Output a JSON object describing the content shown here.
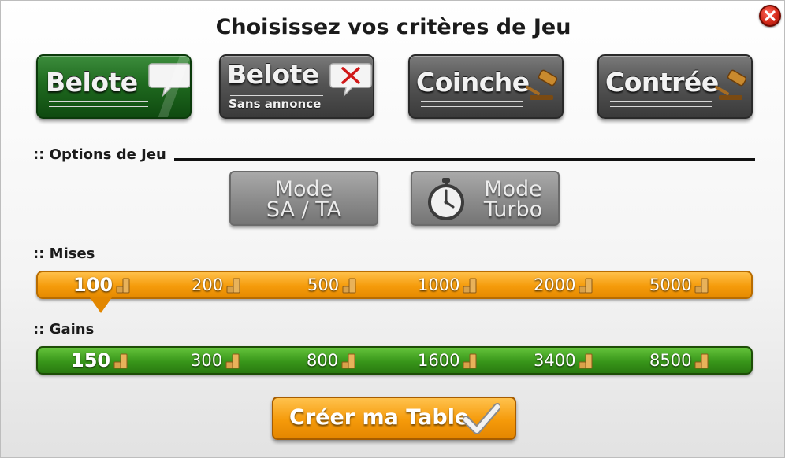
{
  "dialog": {
    "title": "Choisissez vos critères de Jeu",
    "close_icon": "close-icon"
  },
  "game_modes": [
    {
      "label": "Belote",
      "sublabel": "",
      "icon": "speech-bubble-icon",
      "selected": true
    },
    {
      "label": "Belote",
      "sublabel": "Sans annonce",
      "icon": "speech-bubble-x-icon",
      "selected": false
    },
    {
      "label": "Coinche",
      "sublabel": "",
      "icon": "gavel-icon",
      "selected": false
    },
    {
      "label": "Contrée",
      "sublabel": "",
      "icon": "gavel-icon",
      "selected": false
    }
  ],
  "options_section": {
    "label": ":: Options de Jeu",
    "mode_sa_ta": {
      "line1": "Mode",
      "line2": "SA / TA"
    },
    "mode_turbo": {
      "line1": "Mode",
      "line2": "Turbo",
      "icon": "stopwatch-icon"
    }
  },
  "mises": {
    "label": ":: Mises",
    "values": [
      "100",
      "200",
      "500",
      "1000",
      "2000",
      "5000"
    ],
    "selected_index": 0
  },
  "gains": {
    "label": ":: Gains",
    "values": [
      "150",
      "300",
      "800",
      "1600",
      "3400",
      "8500"
    ],
    "selected_index": 0
  },
  "create_button": {
    "label": "Créer ma Table",
    "icon": "checkmark-icon"
  },
  "colors": {
    "selected_green": "#1f6a1f",
    "neutral_grey": "#545454",
    "accent_orange": "#f59b0b",
    "gains_green": "#38961a",
    "close_red": "#d42a1a"
  }
}
